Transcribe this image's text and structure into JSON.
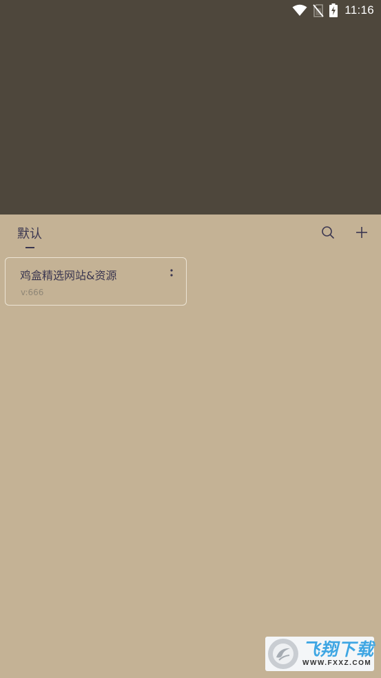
{
  "status_bar": {
    "time": "11:16",
    "icons": [
      "wifi-icon",
      "no-sim-icon",
      "battery-charging-icon"
    ]
  },
  "header": {
    "tabs": [
      {
        "label": "默认",
        "active": true
      }
    ],
    "actions": [
      "search-icon",
      "plus-icon"
    ]
  },
  "items": [
    {
      "title": "鸡盒精选网站&资源",
      "version": "v:666",
      "menu_icon": "more-vertical-icon"
    }
  ],
  "watermark": {
    "main": "飞翔下载",
    "sub": "WWW.FXXZ.COM"
  },
  "colors": {
    "top_background": "#4e473c",
    "page_background": "#c4b295",
    "text_primary": "#3a3650",
    "text_secondary": "#8f8676",
    "card_border": "#ece4d4",
    "watermark_blue": "#3ea6e3"
  }
}
